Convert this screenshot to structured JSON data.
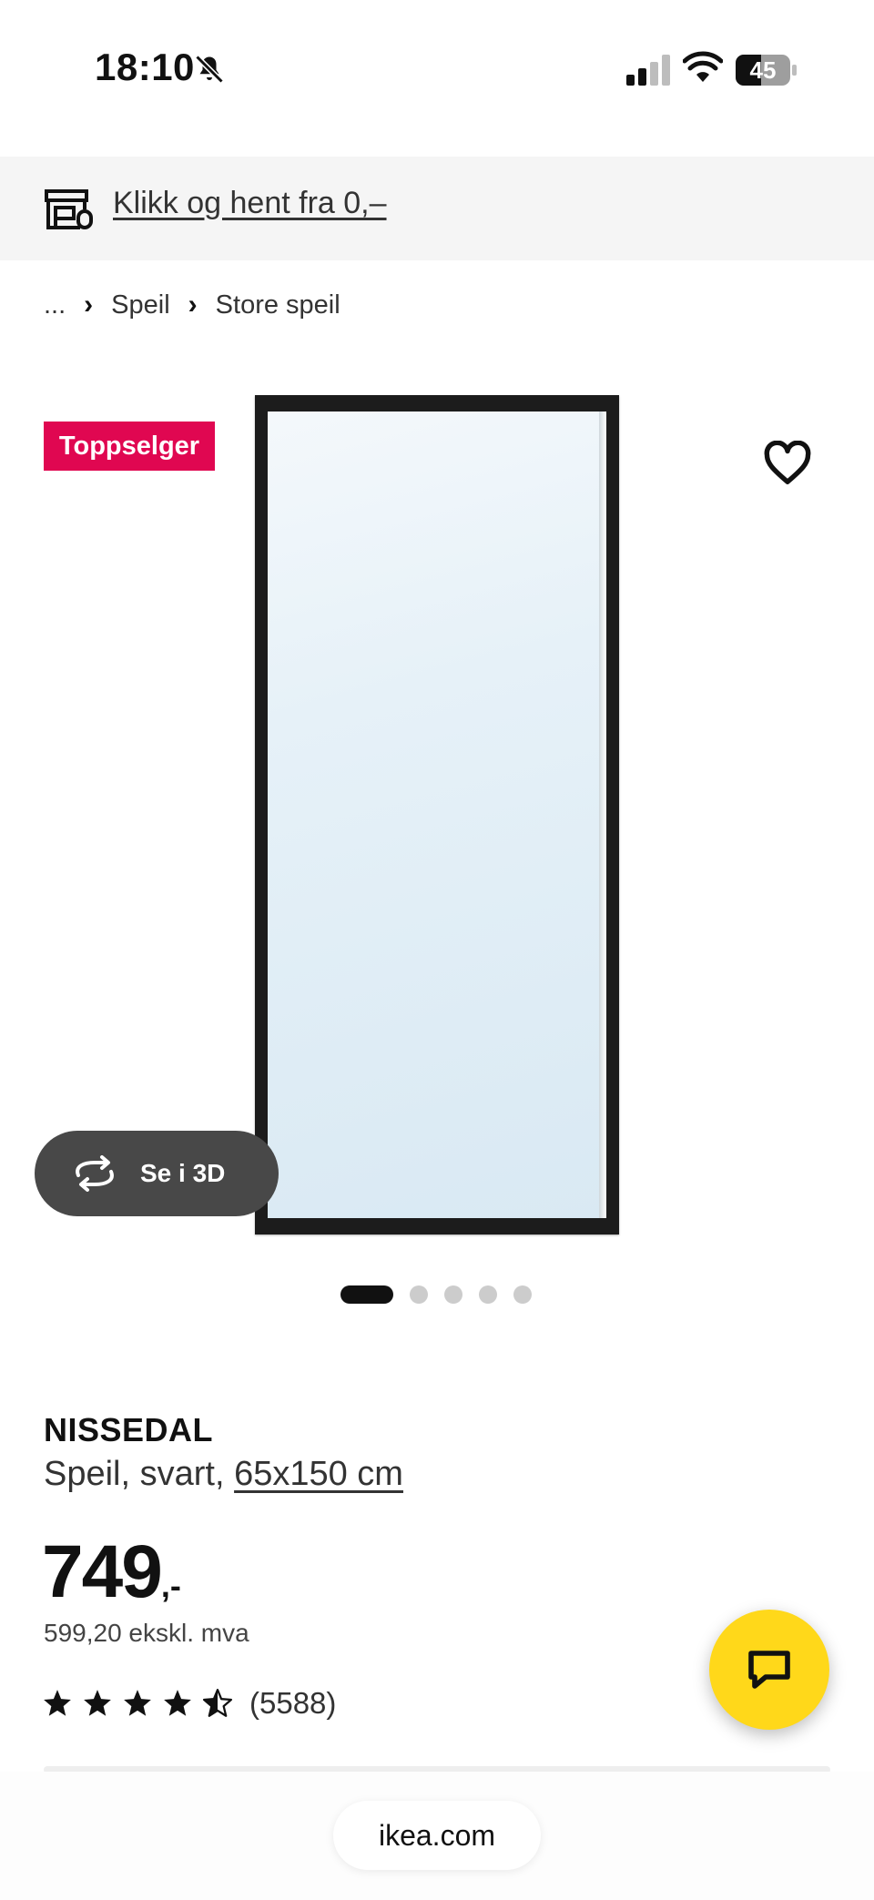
{
  "status_bar": {
    "time": "18:10",
    "battery": "45",
    "icons": [
      "bell-slash-icon",
      "signal-icon",
      "wifi-icon",
      "battery-icon"
    ]
  },
  "banner": {
    "icon": "store-icon",
    "link_text": "Klikk og hent fra 0,–"
  },
  "breadcrumb": {
    "items": [
      "...",
      "Speil",
      "Store speil"
    ]
  },
  "gallery": {
    "badge": "Toppselger",
    "see_3d_label": "Se i 3D",
    "dots_total": 5,
    "active_index": 0
  },
  "product": {
    "name": "NISSEDAL",
    "description_prefix": "Speil, svart, ",
    "size": "65x150 cm",
    "price": "749",
    "price_suffix": ",-",
    "price_ex_vat": "599,20 ekskl. mva",
    "rating": 4.5,
    "review_count": "(5588)"
  },
  "browser": {
    "url": "ikea.com"
  },
  "colors": {
    "badge": "#e00751",
    "chat_button": "#ffd81a",
    "banner_bg": "#f5f5f5"
  }
}
